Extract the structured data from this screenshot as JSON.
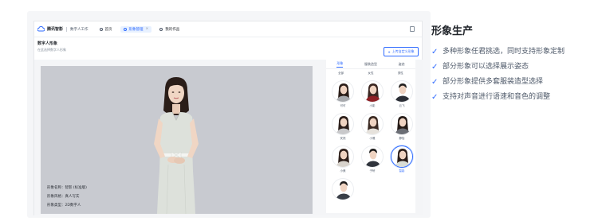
{
  "app": {
    "brand": "腾讯智影",
    "breadcrumb": "数字人工作",
    "tabs": [
      {
        "label": "首页",
        "active": false
      },
      {
        "label": "形象管理",
        "active": true
      },
      {
        "label": "我的作品",
        "active": false
      }
    ]
  },
  "page_header": {
    "title": "数字人形象",
    "subtitle": "在此选择数字人形象",
    "upload_label": "上传自定义形象"
  },
  "preview": {
    "info_lines": [
      "形象名称：智影 (标准版)",
      "形象风格：真人写实",
      "形象类型：2D数字人"
    ]
  },
  "picker": {
    "tabs": [
      {
        "label": "形象",
        "active": true
      },
      {
        "label": "服装造型",
        "active": false
      },
      {
        "label": "姿态",
        "active": false
      }
    ],
    "categories": [
      "全部",
      "女性",
      "男性"
    ],
    "avatars": [
      {
        "name": "可可",
        "gender": "f",
        "hair": "#2a1d18",
        "outfit": "#a7a9ad",
        "selected": false
      },
      {
        "name": "小影",
        "gender": "f",
        "hair": "#3a2621",
        "outfit": "#8e1f24",
        "selected": false
      },
      {
        "name": "云飞",
        "gender": "m",
        "hair": "#22201f",
        "outfit": "#2c2f36",
        "selected": false
      },
      {
        "name": "安然",
        "gender": "f",
        "hair": "#2b1e1a",
        "outfit": "#c9c9cb",
        "selected": false
      },
      {
        "name": "小雅",
        "gender": "f",
        "hair": "#3b2a23",
        "outfit": "#e6e2dc",
        "selected": false
      },
      {
        "name": "静怡",
        "gender": "f",
        "hair": "#241a16",
        "outfit": "#6b6e75",
        "selected": false
      },
      {
        "name": "小美",
        "gender": "f",
        "hair": "#2f211c",
        "outfit": "#d8d3cc",
        "selected": false
      },
      {
        "name": "子轩",
        "gender": "m",
        "hair": "#1e1c1b",
        "outfit": "#30343c",
        "selected": false
      },
      {
        "name": "智影",
        "gender": "f",
        "hair": "#2c1f1a",
        "outfit": "#d9ddd6",
        "selected": true
      },
      {
        "name": "",
        "gender": "m",
        "hair": "#1f1d1c",
        "outfit": "#3a3f48",
        "selected": false
      }
    ]
  },
  "feature_panel": {
    "title": "形象生产",
    "features": [
      "多种形象任君挑选，同时支持形象定制",
      "部分形象可以选择展示姿态",
      "部分形象提供多套服装造型选择",
      "支持对声音进行语速和音色的调整"
    ],
    "check_icon": "check-icon",
    "accent": "#2f6bff"
  }
}
